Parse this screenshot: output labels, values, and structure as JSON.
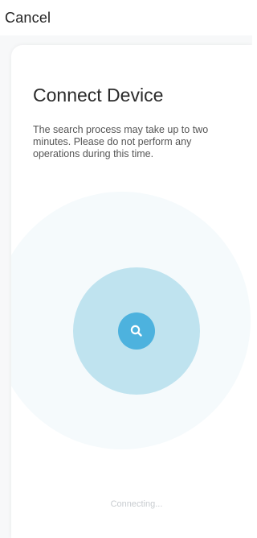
{
  "header": {
    "cancel_label": "Cancel"
  },
  "card": {
    "title": "Connect Device",
    "description": "The search process may take up to two minutes. Please do not perform any operations during this time.",
    "status": "Connecting..."
  },
  "icons": {
    "search": "search-icon"
  },
  "colors": {
    "accent": "#4db2de",
    "inner_ring": "#bfe3ef",
    "outer_ring": "#f5fafc",
    "status_text": "#c8ccd0"
  }
}
